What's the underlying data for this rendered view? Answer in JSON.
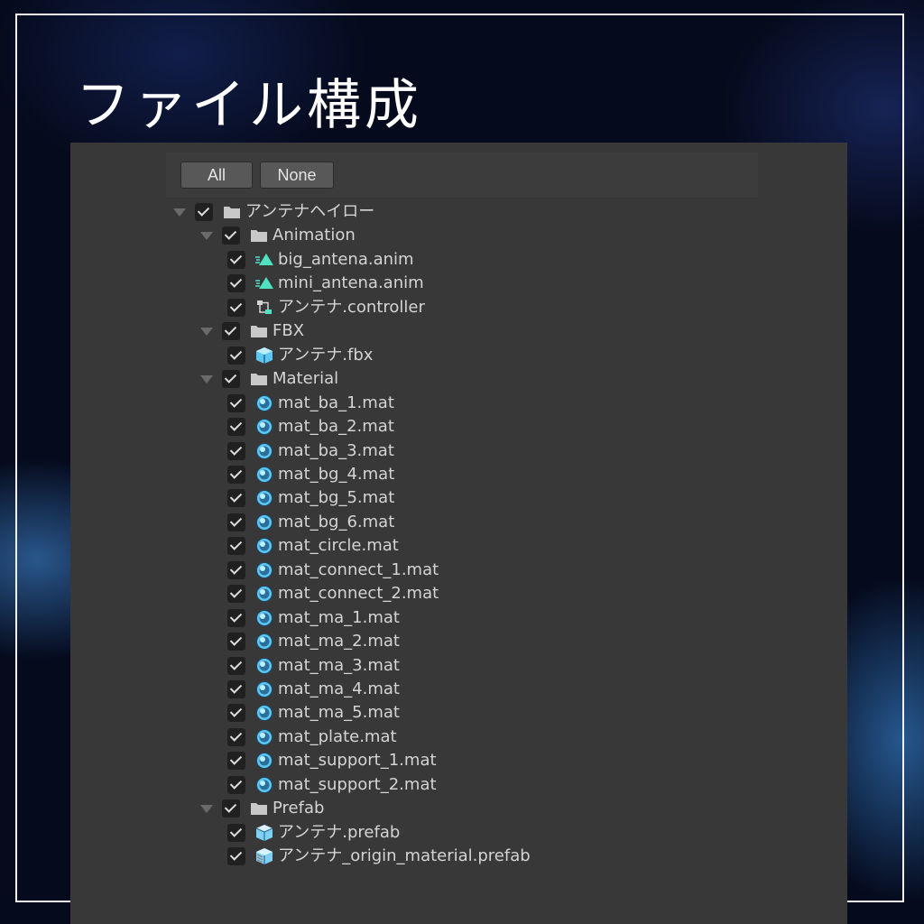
{
  "title": "ファイル構成",
  "toolbar": {
    "all_label": "All",
    "none_label": "None"
  },
  "tree": [
    {
      "label": "アンテナヘイロー",
      "icon": "folder-icon",
      "depth": 0,
      "foldout": true
    },
    {
      "label": "Animation",
      "icon": "folder-icon",
      "depth": 1,
      "foldout": true
    },
    {
      "label": "big_antena.anim",
      "icon": "animation-clip-icon",
      "depth": 2
    },
    {
      "label": "mini_antena.anim",
      "icon": "animation-clip-icon",
      "depth": 2
    },
    {
      "label": "アンテナ.controller",
      "icon": "animator-controller-icon",
      "depth": 2
    },
    {
      "label": "FBX",
      "icon": "folder-icon",
      "depth": 1,
      "foldout": true
    },
    {
      "label": "アンテナ.fbx",
      "icon": "model-icon",
      "depth": 2
    },
    {
      "label": "Material",
      "icon": "folder-icon",
      "depth": 1,
      "foldout": true
    },
    {
      "label": "mat_ba_1.mat",
      "icon": "material-icon",
      "depth": 2
    },
    {
      "label": "mat_ba_2.mat",
      "icon": "material-icon",
      "depth": 2
    },
    {
      "label": "mat_ba_3.mat",
      "icon": "material-icon",
      "depth": 2
    },
    {
      "label": "mat_bg_4.mat",
      "icon": "material-icon",
      "depth": 2
    },
    {
      "label": "mat_bg_5.mat",
      "icon": "material-icon",
      "depth": 2
    },
    {
      "label": "mat_bg_6.mat",
      "icon": "material-icon",
      "depth": 2
    },
    {
      "label": "mat_circle.mat",
      "icon": "material-icon",
      "depth": 2
    },
    {
      "label": "mat_connect_1.mat",
      "icon": "material-icon",
      "depth": 2
    },
    {
      "label": "mat_connect_2.mat",
      "icon": "material-icon",
      "depth": 2
    },
    {
      "label": "mat_ma_1.mat",
      "icon": "material-icon",
      "depth": 2
    },
    {
      "label": "mat_ma_2.mat",
      "icon": "material-icon",
      "depth": 2
    },
    {
      "label": "mat_ma_3.mat",
      "icon": "material-icon",
      "depth": 2
    },
    {
      "label": "mat_ma_4.mat",
      "icon": "material-icon",
      "depth": 2
    },
    {
      "label": "mat_ma_5.mat",
      "icon": "material-icon",
      "depth": 2
    },
    {
      "label": "mat_plate.mat",
      "icon": "material-icon",
      "depth": 2
    },
    {
      "label": "mat_support_1.mat",
      "icon": "material-icon",
      "depth": 2
    },
    {
      "label": "mat_support_2.mat",
      "icon": "material-icon",
      "depth": 2
    },
    {
      "label": "Prefab",
      "icon": "folder-icon",
      "depth": 1,
      "foldout": true
    },
    {
      "label": "アンテナ.prefab",
      "icon": "prefab-icon",
      "depth": 2
    },
    {
      "label": "アンテナ_origin_material.prefab",
      "icon": "prefab-variant-icon",
      "depth": 2
    }
  ],
  "colors": {
    "panel": "#383838",
    "material": "#5cc8f5",
    "anim": "#4de3c0",
    "folder": "#c8c8c8"
  }
}
